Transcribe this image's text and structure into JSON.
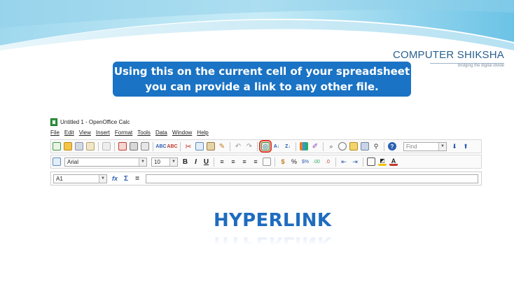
{
  "brand": {
    "name": "COMPUTER SHIKSHA",
    "tagline": "bridging the digital divide"
  },
  "caption": {
    "line1": "Using this on the current cell of your spreadsheet",
    "line2": "you can provide a link to any other file."
  },
  "window": {
    "title": "Untitled 1 - OpenOffice Calc",
    "menu": [
      "File",
      "Edit",
      "View",
      "Insert",
      "Format",
      "Tools",
      "Data",
      "Window",
      "Help"
    ]
  },
  "toolbar": {
    "find_placeholder": "Find",
    "font_name": "Arial",
    "font_size": "10",
    "bold": "B",
    "italic": "I",
    "underline": "U",
    "cell_ref": "A1",
    "fx": "fx",
    "sum": "Σ",
    "equals": "="
  },
  "heading": {
    "text": "HYPERLINK"
  },
  "colors": {
    "caption_bg": "#1a73c4",
    "heading": "#1e6cbf",
    "highlight": "#e03a2a"
  },
  "icons": [
    "new-icon",
    "open-icon",
    "save-icon",
    "email-icon",
    "edit-file-icon",
    "export-pdf-icon",
    "print-icon",
    "print-preview-icon",
    "spellcheck-icon",
    "autospellcheck-icon",
    "cut-icon",
    "copy-icon",
    "paste-icon",
    "clone-formatting-icon",
    "undo-icon",
    "redo-icon",
    "hyperlink-icon",
    "sort-ascending-icon",
    "sort-descending-icon",
    "insert-chart-icon",
    "show-draw-functions-icon",
    "find-replace-icon",
    "navigator-icon",
    "gallery-icon",
    "data-sources-icon",
    "zoom-icon",
    "help-icon"
  ]
}
